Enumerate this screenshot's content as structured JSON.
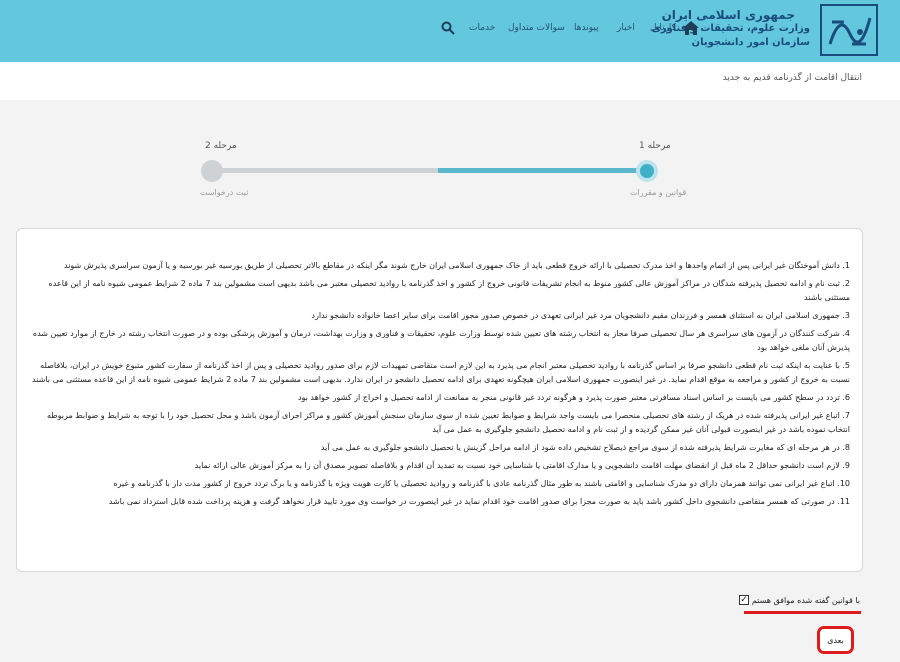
{
  "header": {
    "org_line1": "جمهوری اسلامی ایران",
    "org_line2": "وزارت علوم، تحقیقات و فناوری",
    "org_line3": "سازمان امور دانشجویان",
    "logo_text": "امور دانشجویان",
    "nav": {
      "home_icon": "home-icon",
      "search_icon": "search-icon",
      "items": [
        "کارتابل",
        "اخبار",
        "پیوندها",
        "سوالات متداول",
        "خدمات"
      ]
    }
  },
  "page": {
    "title": "انتقال اقامت از گذرنامه قدیم به جدید"
  },
  "steps": [
    {
      "label": "مرحله 1",
      "sub": "قوانین و مقررات",
      "active": true
    },
    {
      "label": "مرحله 2",
      "sub": "ثبت درخواست",
      "active": false
    }
  ],
  "progress": {
    "fraction": 0.48
  },
  "terms": [
    "1. دانش آموختگان غیر ایرانی پس از اتمام واحدها و اخذ مدرک تحصیلی با ارائه خروج قطعی باید از خاک جمهوری اسلامی ایران خارج شوند مگر اینکه در مقاطع بالاتر تحصیلی از طریق بورسیه غیر بورسیه و یا آزمون سراسری پذیرش شوند",
    "2. ثبت نام و ادامه تحصیل پذیرفته شدگان در مراکز آموزش عالی کشور منوط به انجام تشریفات قانونی خروج از کشور و اخذ گذرنامه با روادید تحصیلی معتبر می باشد بدیهی است مشمولین بند 7 ماده 2 شرایط عمومی شیوه نامه از این قاعده مستثنی باشند",
    "3. جمهوری اسلامی ایران به استثنای همسر و فرزندان مقیم دانشجویان مرد غیر ایرانی تعهدی در خصوص صدور مجوز اقامت برای سایر اعضا خانواده دانشجو ندارد",
    "4. شرکت کنندگان در آزمون های سراسری هر سال تحصیلی صرفا مجاز به انتخاب رشته های تعیین شده توسط وزارت علوم، تحقیقات و فناوری و وزارت بهداشت، درمان و آموزش پزشکی بوده و در صورت انتخاب رشته در خارج از موارد تعیین شده پذیرش آنان ملغی خواهد بود",
    "5. با عنایت به اینکه ثبت نام قطعی دانشجو صرفا بر اساس گذرنامه با روادید تحصیلی معتبر انجام می پذیرد به ‌این لازم است متقاضی تمهیدات لازم برای صدور روادید تحصیلی و پس از اخذ گذرنامه از سفارت کشور متبوع خویش در ایران، بلافاصله نسبت به خروج از کشور و مراجعه به موقع اقدام نماید. در غیر اینصورت جمهوری اسلامی ایران هیچگونه تعهدی برای ادامه تحصیل دانشجو در ایران ندارد. بدیهی است مشمولین بند 7 ماده 2 شرایط عمومی شیوه نامه از این قاعده مستثنی می باشند",
    "6. تردد در سطح کشور می بایست بر اساس اسناد مسافرتی معتبر صورت پذیرد و هرگونه تردد غیر قانونی منجر به ممانعت از ادامه تحصیل و اخراج از کشور خواهد بود",
    "7. اتباع غیر ایرانی پذیرفته شده در هریک از رشته های تحصیلی منحصرا می بایست واجد شرایط و ضوابط تعیین شده از سوی سازمان سنجش آموزش کشور و مراکز اجرای آزمون باشد و محل تحصیل خود را با توجه به شرایط و ضوابط مربوطه انتخاب نموده باشد در غیر اینصورت قبولی آنان غیر ممکن گردیده و از ثبت نام و ادامه تحصیل دانشجو جلوگیری به عمل می آید",
    "8. در هر مرحله ای که مغایرت شرایط پذیرفته شده از سوی مراجع ذیصلاح تشخیص داده شود از ادامه مراحل گزینش یا تحصیل دانشجو جلوگیری به عمل می آید",
    "9. لازم است دانشجو حداقل 2 ماه قبل از انقضای مهلت اقامت دانشجویی و یا مدارک اقامتی یا شناسایی خود نسبت به تمدید آن اقدام و بلافاصله تصویر مصدق آن را به مرکز آموزش عالی ارائه نماید",
    "10. اتباع غیر ایرانی نمی توانند همزمان دارای دو مدرک شناسایی و اقامتی باشند به طور مثال گذرنامه عادی با گذرنامه و روادید تحصیلی یا کارت هویت ویژه با گذرنامه و یا برگ تردد خروج از کشور مدت دار با گذرنامه و غیره",
    "11. در صورتی که همسر متقاضی دانشجوی داخل کشور باشد باید به صورت مجزا برای صدور اقامت خود اقدام نماید در غیر اینصورت در خواست وی مورد تایید قرار نخواهد گرفت و هزینه پرداخت شده قابل استرداد نمی باشد"
  ],
  "agreement": {
    "label": "با قوانین گفته شده موافق هستم",
    "checked": true
  },
  "next_button": "بعدی",
  "colors": {
    "header_bg": "#63c8de",
    "accent": "#3fb0c7",
    "highlight": "#e01b1b"
  }
}
